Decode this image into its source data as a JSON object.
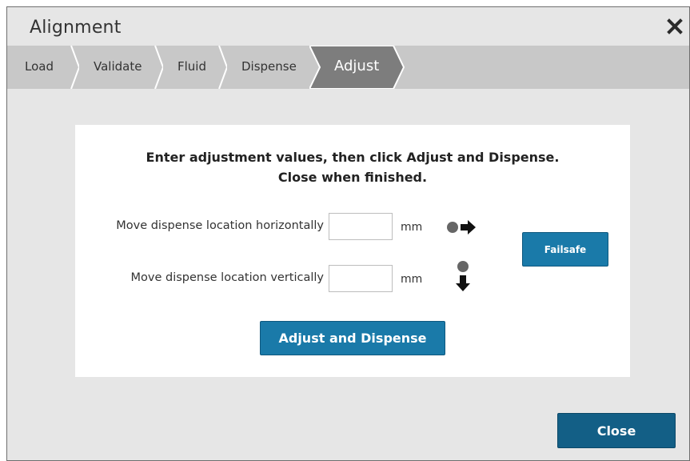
{
  "dialog": {
    "title": "Alignment",
    "close_icon": "close-x-icon"
  },
  "steps": [
    {
      "label": "Load",
      "active": false
    },
    {
      "label": "Validate",
      "active": false
    },
    {
      "label": "Fluid",
      "active": false
    },
    {
      "label": "Dispense",
      "active": false
    },
    {
      "label": "Adjust",
      "active": true
    }
  ],
  "instructions": {
    "line1": "Enter adjustment values, then click Adjust and Dispense.",
    "line2": "Close when finished."
  },
  "horizontal": {
    "label": "Move dispense location horizontally",
    "value": "",
    "unit": "mm",
    "icon": "move-right-icon"
  },
  "vertical": {
    "label": "Move dispense location vertically",
    "value": "",
    "unit": "mm",
    "icon": "move-down-icon"
  },
  "buttons": {
    "failsafe": "Failsafe",
    "adjust_dispense": "Adjust and Dispense",
    "close": "Close"
  },
  "colors": {
    "accent": "#1a7aa9",
    "close_button": "#135f86",
    "active_step": "#7d7d7d",
    "step_bar": "#c8c8c8",
    "dialog_bg": "#e6e6e6"
  }
}
